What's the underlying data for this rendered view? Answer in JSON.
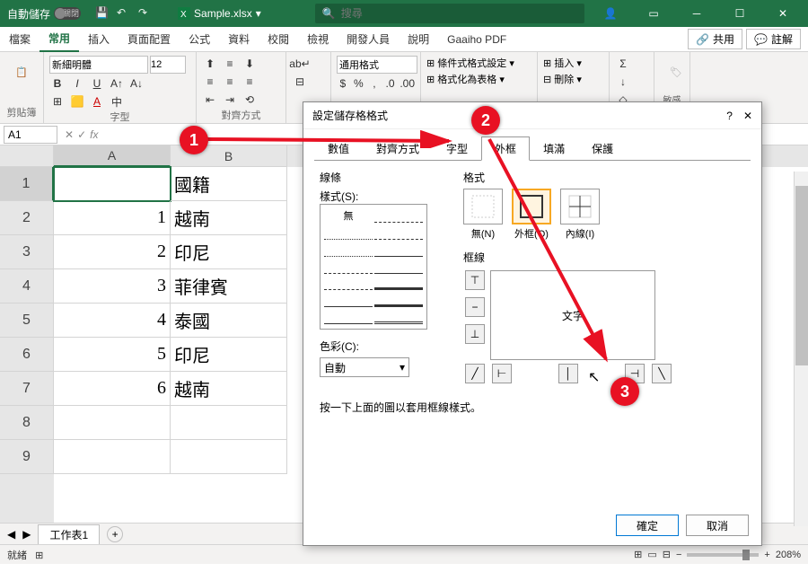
{
  "titlebar": {
    "autosave_label": "自動儲存",
    "autosave_toggle": "關閉",
    "filename": "Sample.xlsx",
    "search_placeholder": "搜尋"
  },
  "ribbon_tabs": [
    "檔案",
    "常用",
    "插入",
    "頁面配置",
    "公式",
    "資料",
    "校閱",
    "檢視",
    "開發人員",
    "說明",
    "Gaaiho PDF"
  ],
  "ribbon_tabs_active": 1,
  "share_label": "共用",
  "comments_label": "註解",
  "ribbon": {
    "font_name": "新細明體",
    "font_size": "12",
    "clipboard_group": "剪貼簿",
    "font_group": "字型",
    "align_group": "對齊方式",
    "number_format": "通用格式",
    "cond_format": "條件式格式設定",
    "format_table": "格式化為表格",
    "insert": "插入",
    "delete": "刪除"
  },
  "name_box": "A1",
  "grid": {
    "row_labels": [
      "1",
      "2",
      "3",
      "4",
      "5",
      "6",
      "7",
      "8",
      "9"
    ],
    "col_A": [
      "",
      "1",
      "2",
      "3",
      "4",
      "5",
      "6",
      "",
      ""
    ],
    "col_B": [
      "國籍",
      "越南",
      "印尼",
      "菲律賓",
      "泰國",
      "印尼",
      "越南",
      "",
      ""
    ]
  },
  "sheet_tab": "工作表1",
  "status": {
    "ready": "就緒",
    "zoom": "208%"
  },
  "dialog": {
    "title": "設定儲存格格式",
    "tabs": [
      "數值",
      "對齊方式",
      "字型",
      "外框",
      "填滿",
      "保護"
    ],
    "tabs_active": 3,
    "line_label": "線條",
    "style_label": "樣式(S):",
    "style_none": "無",
    "color_label": "色彩(C):",
    "color_value": "自動",
    "preset_label": "格式",
    "preset_none": "無(N)",
    "preset_outline": "外框(O)",
    "preset_inside": "內線(I)",
    "border_label": "框線",
    "preview_text": "文字",
    "hint": "按一下上面的圖以套用框線樣式。",
    "ok": "確定",
    "cancel": "取消"
  },
  "badges": [
    "1",
    "2",
    "3"
  ]
}
